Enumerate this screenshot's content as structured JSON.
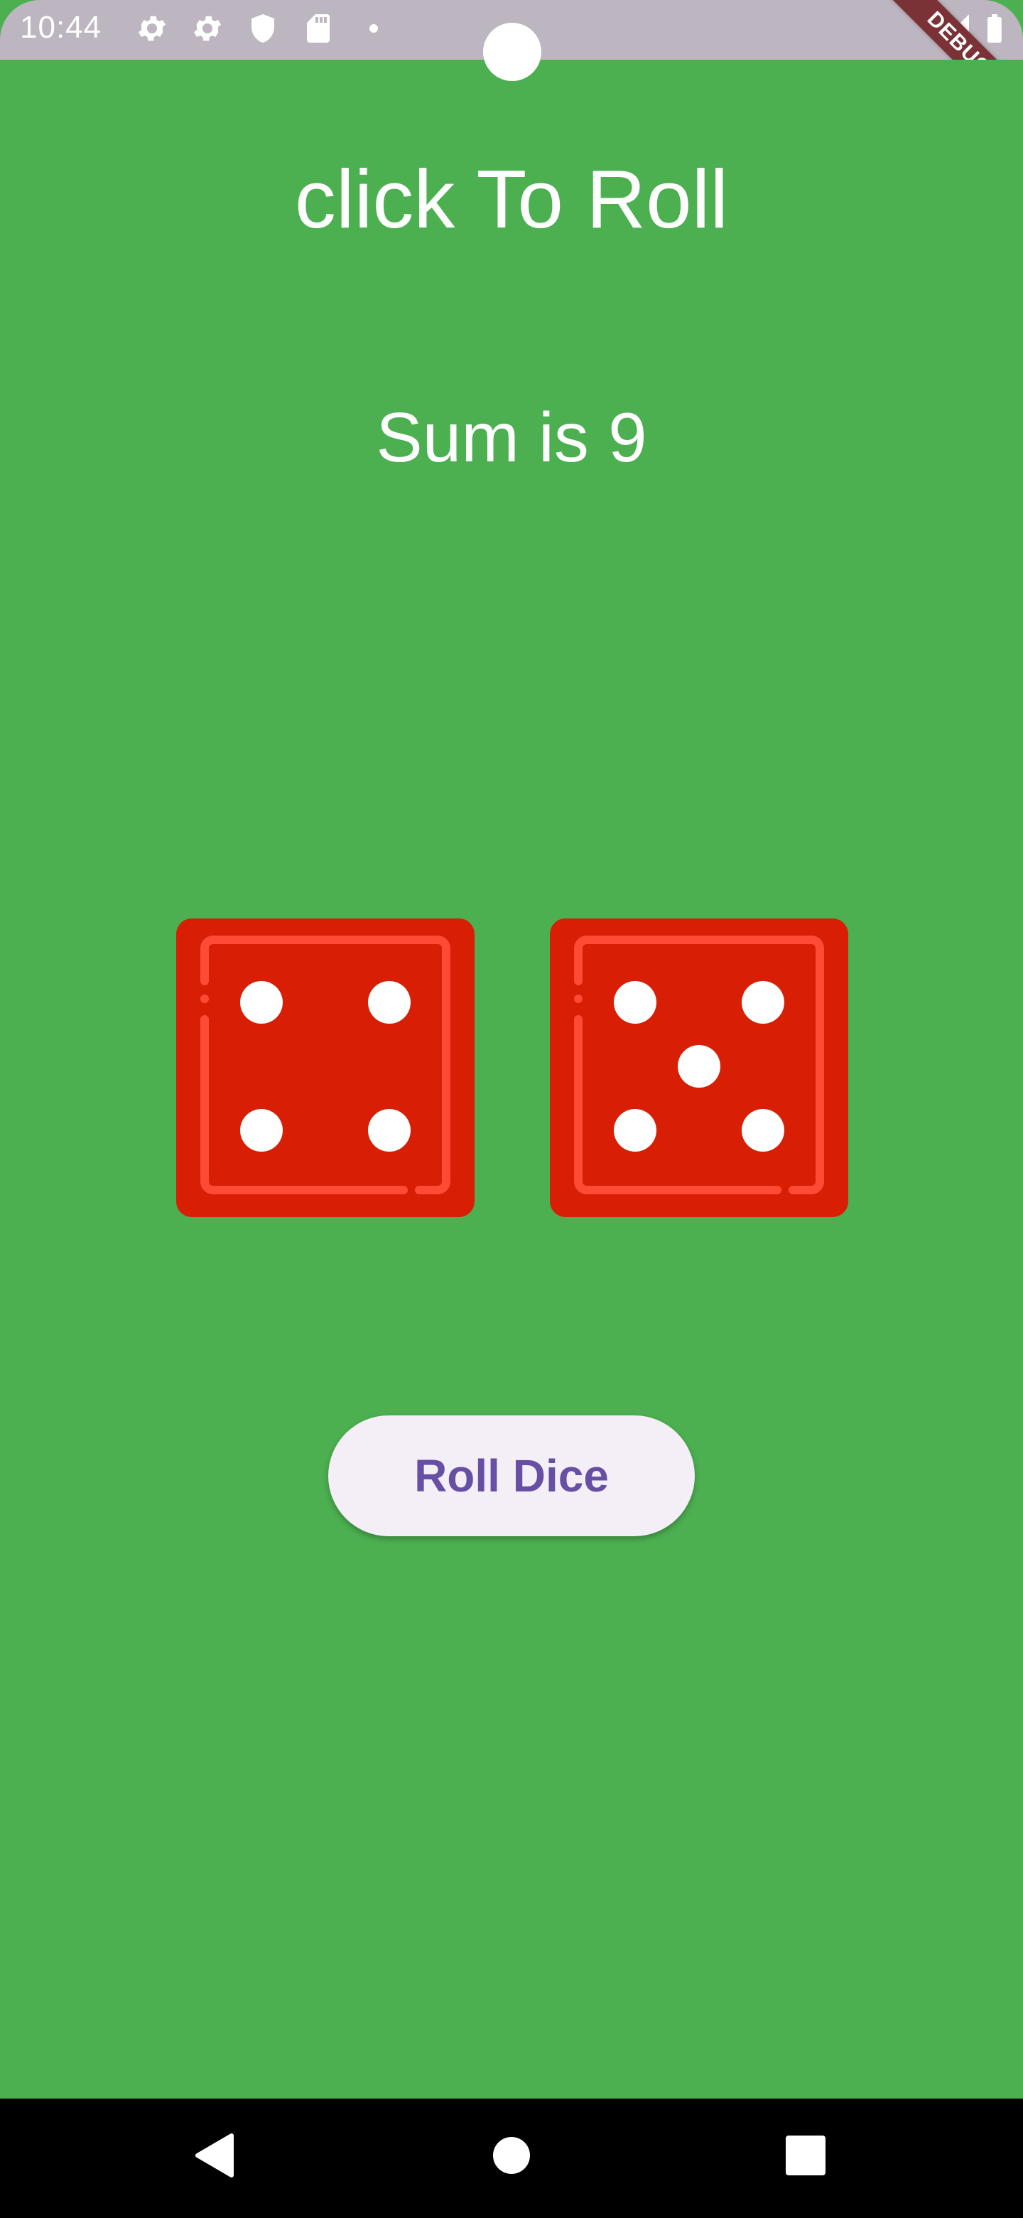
{
  "status_bar": {
    "time": "10:44",
    "icons": [
      "gear-icon",
      "gear-icon",
      "shield-icon",
      "sd-card-icon",
      "dot-icon",
      "signal-icon",
      "battery-icon"
    ],
    "debug_label": "DEBUG"
  },
  "main": {
    "title": "click To Roll",
    "sum_text": "Sum is 9",
    "dice": [
      {
        "name": "left-die",
        "face": 4
      },
      {
        "name": "right-die",
        "face": 5
      }
    ],
    "roll_button_label": "Roll Dice"
  },
  "nav_bar": {
    "buttons": [
      "back-icon",
      "home-icon",
      "recents-icon"
    ]
  },
  "colors": {
    "background": "#4caf50",
    "die_fill": "#d81e05",
    "die_inner_stroke": "#ff4a35",
    "pip": "#ffffff",
    "button_bg": "#f4eff7",
    "button_text": "#6750a4"
  }
}
